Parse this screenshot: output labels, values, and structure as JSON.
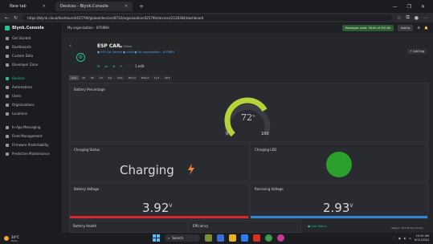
{
  "browser": {
    "tabs": [
      {
        "label": "New tab",
        "active": false
      },
      {
        "label": "Devices - Blynk.Console",
        "active": true
      }
    ],
    "url": "https://blynk.cloud/dashboard/425790/global/devices/8732/organization/425790/devices/2128384/dashboard"
  },
  "sidebar": {
    "logo": "Blynk.Console",
    "items": [
      {
        "label": "Get Started"
      },
      {
        "label": "Dashboards"
      },
      {
        "label": "Custom Data"
      },
      {
        "label": "Developer Zone"
      },
      {
        "label": "Devices",
        "active": true
      },
      {
        "label": "Automations"
      },
      {
        "label": "Users"
      },
      {
        "label": "Organizations"
      },
      {
        "label": "Locations"
      },
      {
        "label": "In-App Messaging"
      },
      {
        "label": "Fleet Management"
      },
      {
        "label": "Firmware Predictability"
      },
      {
        "label": "Predictive Maintenance"
      }
    ]
  },
  "topbar": {
    "org": "My organization - 8709BH",
    "region_badge": "Messages used: 28.0k of 300.0k",
    "region": "Region: blr1",
    "account": "Add to"
  },
  "device": {
    "name": "ESP CAR",
    "tag": "● Online",
    "meta": "● ESP Car Device   ● Ankit   ● My organization - 8709BH",
    "actions_label": "1 edit",
    "add_tag": "+ Add tag"
  },
  "time_ranges": [
    "Live",
    "1h",
    "6h",
    "1d",
    "1w",
    "1mo",
    "3mo ▾",
    "6mo ▾",
    "1y ▾",
    "All ▾"
  ],
  "widgets": {
    "battery_percentage": {
      "title": "Battery Percentage",
      "value": "72",
      "unit": "%",
      "min": "0",
      "max": "100"
    },
    "charging_status": {
      "title": "Charging Status",
      "value": "Charging"
    },
    "charging_led": {
      "title": "Charging LED"
    },
    "battery_voltage": {
      "title": "Battery Voltage",
      "value": "3.92",
      "unit": "V"
    },
    "receiving_voltage": {
      "title": "Receiving Voltage",
      "value": "2.93",
      "unit": "V"
    },
    "battery_health": {
      "title": "Battery Health"
    },
    "efficiency": {
      "title": "Efficiency"
    },
    "live_status": {
      "title": "● Live Status"
    }
  },
  "footer_region": "Region: blr1   Privacy Policy",
  "taskbar": {
    "temp": "34°C",
    "weather": "Haze",
    "search": "Search",
    "time": "10:30 AM",
    "date": "6/11/2024"
  },
  "colors": {
    "accent": "#23c48e",
    "gauge": "#b5d33a",
    "led": "#2ca02c",
    "bolt": "#f08a2b",
    "voltage_bar": "#d8262b",
    "receiving_bar": "#2d86d6"
  }
}
